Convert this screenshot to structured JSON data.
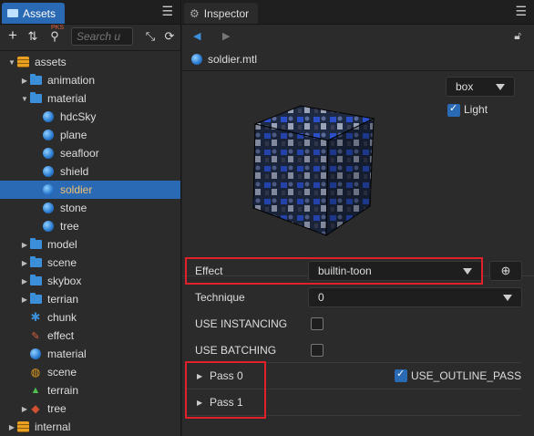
{
  "assets_panel": {
    "tab_label": "Assets",
    "search_placeholder": "Search u",
    "filter_badge": "PKS",
    "tree": [
      {
        "label": "assets",
        "icon": "database-icon",
        "arrow": "down",
        "depth": 0
      },
      {
        "label": "animation",
        "icon": "folder-icon",
        "arrow": "right",
        "depth": 1
      },
      {
        "label": "material",
        "icon": "folder-icon",
        "arrow": "down",
        "depth": 1
      },
      {
        "label": "hdcSky",
        "icon": "material-icon",
        "arrow": "",
        "depth": 2
      },
      {
        "label": "plane",
        "icon": "material-icon",
        "arrow": "",
        "depth": 2
      },
      {
        "label": "seafloor",
        "icon": "material-icon",
        "arrow": "",
        "depth": 2
      },
      {
        "label": "shield",
        "icon": "material-icon",
        "arrow": "",
        "depth": 2
      },
      {
        "label": "soldier",
        "icon": "material-icon",
        "arrow": "",
        "depth": 2,
        "selected": true
      },
      {
        "label": "stone",
        "icon": "material-icon",
        "arrow": "",
        "depth": 2
      },
      {
        "label": "tree",
        "icon": "material-icon",
        "arrow": "",
        "depth": 2
      },
      {
        "label": "model",
        "icon": "folder-icon",
        "arrow": "right",
        "depth": 1
      },
      {
        "label": "scene",
        "icon": "folder-icon",
        "arrow": "right",
        "depth": 1
      },
      {
        "label": "skybox",
        "icon": "folder-icon",
        "arrow": "right",
        "depth": 1
      },
      {
        "label": "terrian",
        "icon": "folder-icon",
        "arrow": "right",
        "depth": 1
      },
      {
        "label": "chunk",
        "icon": "chunk-icon",
        "arrow": "",
        "depth": 1
      },
      {
        "label": "effect",
        "icon": "effect-icon",
        "arrow": "",
        "depth": 1
      },
      {
        "label": "material",
        "icon": "material-icon",
        "arrow": "",
        "depth": 1
      },
      {
        "label": "scene",
        "icon": "scene-icon",
        "arrow": "",
        "depth": 1
      },
      {
        "label": "terrain",
        "icon": "terrain-icon",
        "arrow": "",
        "depth": 1
      },
      {
        "label": "tree",
        "icon": "prefab-icon",
        "arrow": "right",
        "depth": 1
      },
      {
        "label": "internal",
        "icon": "database-icon",
        "arrow": "right",
        "depth": 0
      }
    ]
  },
  "inspector": {
    "tab_label": "Inspector",
    "file_name": "soldier.mtl",
    "preview_shape": "box",
    "light_label": "Light",
    "light_checked": true,
    "effect_label": "Effect",
    "effect_value": "builtin-toon",
    "technique_label": "Technique",
    "technique_value": "0",
    "use_instancing_label": "USE INSTANCING",
    "use_batching_label": "USE BATCHING",
    "pass0_label": "Pass 0",
    "pass1_label": "Pass 1",
    "outline_label": "USE_OUTLINE_PASS",
    "outline_checked": true
  },
  "colors": {
    "accent": "#2a69b3",
    "selected_text": "#f0c070",
    "highlight_red": "#e0202a"
  }
}
